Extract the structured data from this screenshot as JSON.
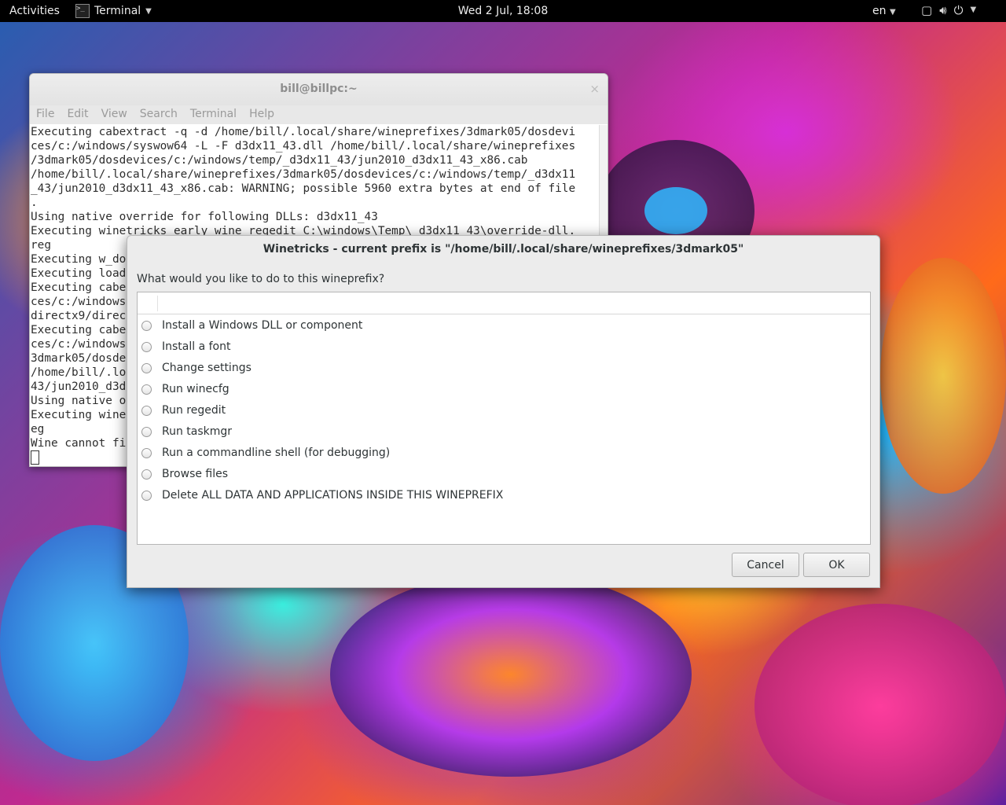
{
  "topbar": {
    "activities": "Activities",
    "app_name": "Terminal",
    "clock": "Wed  2 Jul, 18:08",
    "language": "en",
    "icons": [
      "window-icon",
      "volume-icon",
      "power-icon"
    ]
  },
  "terminal": {
    "title": "bill@billpc:~",
    "menu": [
      "File",
      "Edit",
      "View",
      "Search",
      "Terminal",
      "Help"
    ],
    "lines": [
      "Executing cabextract -q -d /home/bill/.local/share/wineprefixes/3dmark05/dosdevi",
      "ces/c:/windows/syswow64 -L -F d3dx11_43.dll /home/bill/.local/share/wineprefixes",
      "/3dmark05/dosdevices/c:/windows/temp/_d3dx11_43/jun2010_d3dx11_43_x86.cab",
      "/home/bill/.local/share/wineprefixes/3dmark05/dosdevices/c:/windows/temp/_d3dx11",
      "_43/jun2010_d3dx11_43_x86.cab: WARNING; possible 5960 extra bytes at end of file",
      ".",
      "Using native override for following DLLs: d3dx11_43",
      "Executing winetricks_early_wine regedit C:\\windows\\Temp\\_d3dx11_43\\override-dll.",
      "reg",
      "Executing w_do",
      "Executing load",
      "Executing cabe",
      "ces/c:/windows",
      "directx9/direc",
      "Executing cabe",
      "ces/c:/windows",
      "3dmark05/dosde",
      "/home/bill/.loc",
      "43/jun2010_d3d",
      "Using native o",
      "Executing wine",
      "eg",
      "Wine cannot fi"
    ]
  },
  "dialog": {
    "title": "Winetricks - current prefix is \"/home/bill/.local/share/wineprefixes/3dmark05\"",
    "question": "What would you like to do to this wineprefix?",
    "options": [
      "Install a Windows DLL or component",
      "Install a font",
      "Change settings",
      "Run winecfg",
      "Run regedit",
      "Run taskmgr",
      "Run a commandline shell (for debugging)",
      "Browse files",
      "Delete ALL DATA AND APPLICATIONS INSIDE THIS WINEPREFIX"
    ],
    "cancel_label": "Cancel",
    "ok_label": "OK"
  }
}
